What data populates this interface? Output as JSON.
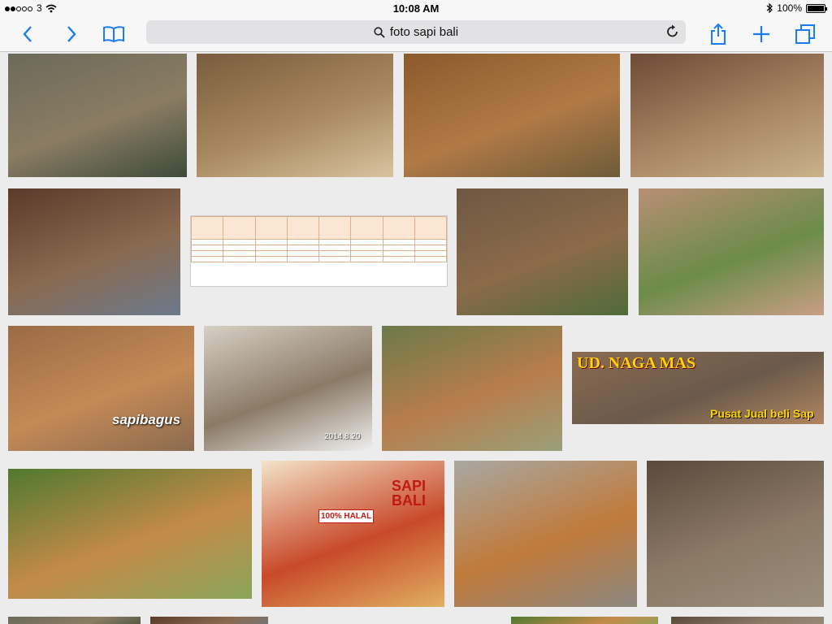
{
  "status_bar": {
    "carrier": "3",
    "time": "10:08 AM",
    "battery": "100%"
  },
  "toolbar": {
    "url_text": "foto sapi bali"
  },
  "tiles": [
    {
      "caption": "",
      "colors": [
        "#6b6a58",
        "#8a7d63",
        "#3e4b3a"
      ]
    },
    {
      "caption": "",
      "colors": [
        "#7a5c3e",
        "#a9895f",
        "#d8c3a1"
      ]
    },
    {
      "caption": "",
      "colors": [
        "#8b5a2b",
        "#b07a45",
        "#6e5b3a"
      ]
    },
    {
      "caption": "",
      "colors": [
        "#6d4b36",
        "#a88563",
        "#c9b28b"
      ]
    },
    {
      "caption": "",
      "colors": [
        "#5b3a2a",
        "#8a6a4f",
        "#6b7a8c"
      ]
    },
    {
      "caption": "",
      "colors": [
        "#ffffff",
        "#fce6d4",
        "#ffffff"
      ]
    },
    {
      "caption": "",
      "colors": [
        "#6e5841",
        "#8c6a4a",
        "#4f6b3a"
      ]
    },
    {
      "caption": "",
      "colors": [
        "#b98e75",
        "#6b8c4a",
        "#c99e85"
      ]
    },
    {
      "caption": "sapibagus",
      "colors": [
        "#9a6b45",
        "#c48a55",
        "#8a6b50"
      ]
    },
    {
      "caption": "2014.8.20",
      "colors": [
        "#d6d0c4",
        "#8a7b66",
        "#efefef"
      ]
    },
    {
      "caption": "",
      "colors": [
        "#6b7a4a",
        "#b87d4b",
        "#9aa07a"
      ]
    },
    {
      "caption": "UD. NAGA MAS",
      "sub": "Pusat Jual beli Sap",
      "colors": [
        "#8a6b50",
        "#6a5a4a",
        "#b08560"
      ]
    },
    {
      "caption": "",
      "colors": [
        "#4f7a2e",
        "#c48a4a",
        "#8aa65a"
      ]
    },
    {
      "caption": "SAPI BALI",
      "sub": "100% HALAL",
      "colors": [
        "#f4e3c8",
        "#c84a2a",
        "#e0b060"
      ]
    },
    {
      "caption": "",
      "colors": [
        "#a8a8a2",
        "#c07a3a",
        "#8c8880"
      ]
    },
    {
      "caption": "",
      "colors": [
        "#5a4a3a",
        "#8a7a66",
        "#9a8e7a"
      ]
    }
  ],
  "icons": {
    "back": "chevron-left-icon",
    "forward": "chevron-right-icon",
    "bookmarks": "book-icon",
    "search": "search-icon",
    "reload": "reload-icon",
    "share": "share-icon",
    "new_tab": "plus-icon",
    "tabs": "tabs-icon"
  }
}
